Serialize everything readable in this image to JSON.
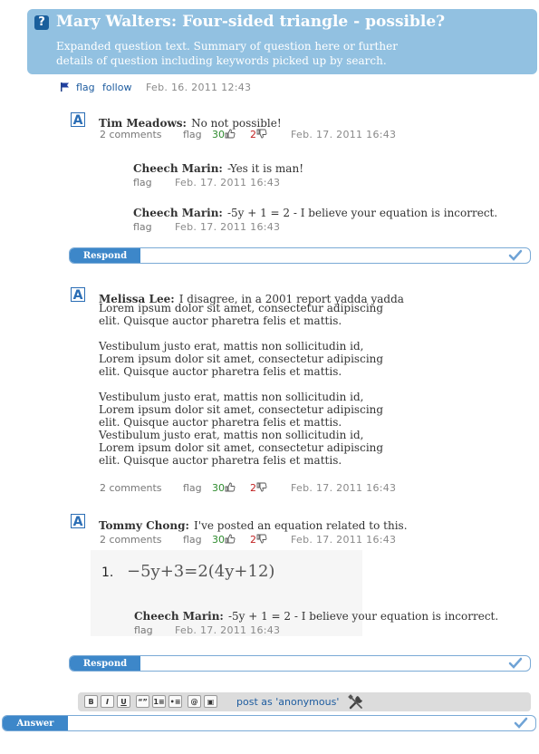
{
  "question": {
    "title": "Mary Walters: Four-sided triangle - possible?",
    "summary": "Expanded question text. Summary of question here or further details of question including keywords picked up by search.",
    "flag": "flag",
    "follow": "follow",
    "date": "Feb. 16. 2011 12:43"
  },
  "answers": [
    {
      "author": "Tim Meadows:",
      "text": "No not possible!",
      "comments_label": "2 comments",
      "flag": "flag",
      "up": "30",
      "down": "2",
      "date": "Feb. 17. 2011 16:43",
      "comments": [
        {
          "author": "Cheech Marin:",
          "text": "-Yes it is man!",
          "flag": "flag",
          "date": "Feb. 17. 2011 16:43"
        },
        {
          "author": "Cheech Marin:",
          "text": "-5y + 1 = 2 - I believe your equation is incorrect.",
          "flag": "flag",
          "date": "Feb. 17. 2011 16:43"
        }
      ],
      "respond": "Respond"
    },
    {
      "author": "Melissa Lee:",
      "first_line": "I disagree, in a 2001 report yadda yadda",
      "body": "Lorem ipsum dolor sit amet, consectetur adipiscing\nelit. Quisque auctor pharetra felis et mattis.\n\nVestibulum justo erat, mattis non sollicitudin id,\nLorem ipsum dolor sit amet, consectetur adipiscing\nelit. Quisque auctor pharetra felis et mattis.\n\nVestibulum justo erat, mattis non sollicitudin id,\nLorem ipsum dolor sit amet, consectetur adipiscing\nelit. Quisque auctor pharetra felis et mattis.\nVestibulum justo erat, mattis non sollicitudin id,\nLorem ipsum dolor sit amet, consectetur adipiscing\nelit. Quisque auctor pharetra felis et mattis.",
      "comments_label": "2 comments",
      "flag": "flag",
      "up": "30",
      "down": "2",
      "date": "Feb. 17. 2011 16:43"
    },
    {
      "author": "Tommy Chong:",
      "text": "I've posted an equation related to this.",
      "comments_label": "2 comments",
      "flag": "flag",
      "up": "30",
      "down": "2",
      "date": "Feb. 17. 2011 16:43",
      "equation_number": "1.",
      "equation": "−5y+3=2(4y+12)",
      "comment": {
        "author": "Cheech Marin:",
        "text": "-5y + 1 = 2 - I believe your equation is incorrect.",
        "flag": "flag",
        "date": "Feb. 17. 2011 16:43"
      },
      "respond": "Respond"
    }
  ],
  "editor": {
    "buttons": [
      "B",
      "I",
      "U",
      "“”",
      "1≡",
      "•≡",
      "@",
      "▣"
    ],
    "post_as": "post as 'anonymous'"
  },
  "answer_label": "Answer",
  "colors": {
    "header_bg": "#92c1e1",
    "accent": "#3d87c9",
    "up": "#2e8b2e",
    "down": "#c02020"
  }
}
